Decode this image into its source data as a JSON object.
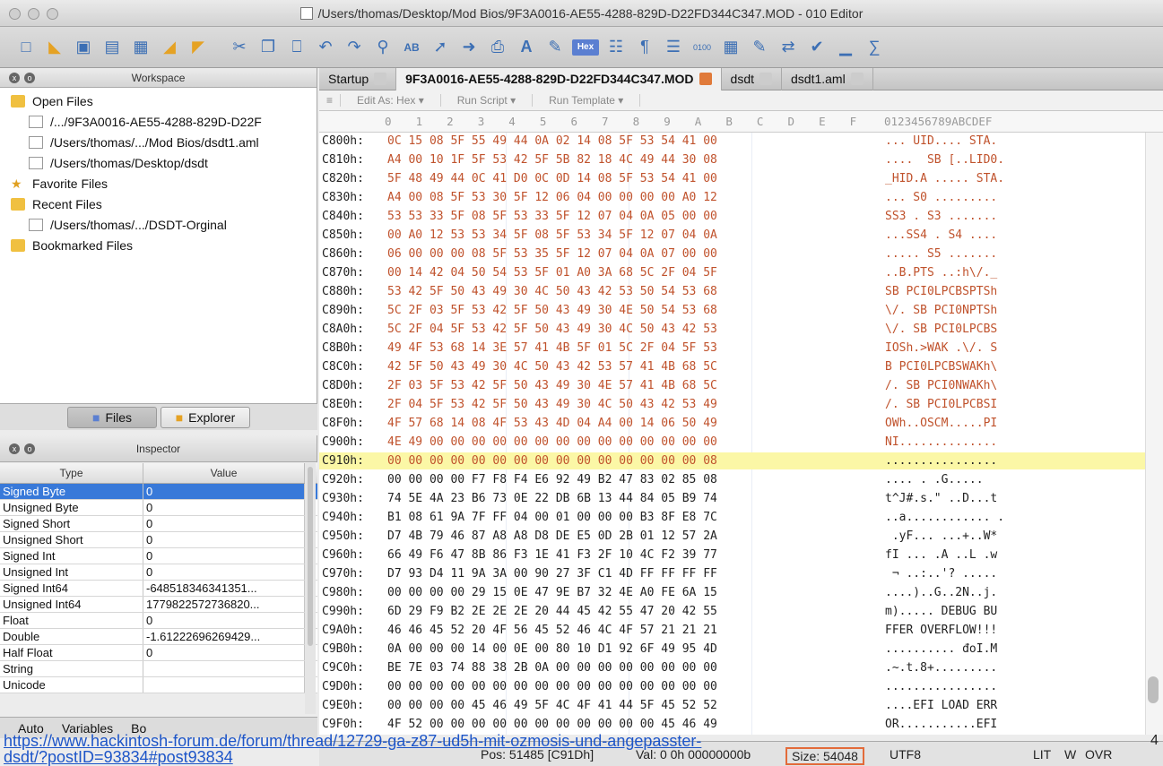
{
  "window": {
    "title": "/Users/thomas/Desktop/Mod Bios/9F3A0016-AE55-4288-829D-D22FD344C347.MOD - 010 Editor"
  },
  "toolbar": {
    "icons": [
      "new-file-icon",
      "open-file-icon",
      "save-icon",
      "save-all-icon",
      "workspace-icon",
      "folder-icon",
      "project-icon",
      "cut-icon",
      "copy-icon",
      "paste-icon",
      "undo-icon",
      "redo-icon",
      "find-icon",
      "replace-icon",
      "goto-icon",
      "jump-icon",
      "print-icon",
      "font-icon",
      "highlight-icon",
      "hex-mode-icon",
      "columns-icon",
      "paragraph-icon",
      "text-view-icon",
      "binary-icon",
      "calculator-icon",
      "template-icon",
      "compare-icon",
      "checksum-icon",
      "histogram-icon",
      "base-converter-icon"
    ],
    "hex_label": "Hex"
  },
  "workspace": {
    "title": "Workspace",
    "items": [
      {
        "label": "Open Files",
        "level": 0,
        "icon": "folder"
      },
      {
        "label": "/.../9F3A0016-AE55-4288-829D-D22F",
        "level": 1,
        "icon": "file"
      },
      {
        "label": "/Users/thomas/.../Mod Bios/dsdt1.aml",
        "level": 1,
        "icon": "file"
      },
      {
        "label": "/Users/thomas/Desktop/dsdt",
        "level": 1,
        "icon": "file"
      },
      {
        "label": "Favorite Files",
        "level": 0,
        "icon": "star"
      },
      {
        "label": "Recent Files",
        "level": 0,
        "icon": "folder"
      },
      {
        "label": "/Users/thomas/.../DSDT-Orginal",
        "level": 1,
        "icon": "file"
      },
      {
        "label": "Bookmarked Files",
        "level": 0,
        "icon": "folder"
      }
    ],
    "tabs": {
      "files": "Files",
      "explorer": "Explorer"
    }
  },
  "inspector": {
    "title": "Inspector",
    "col_type": "Type",
    "col_value": "Value",
    "rows": [
      {
        "type": "Signed Byte",
        "value": "0"
      },
      {
        "type": "Unsigned Byte",
        "value": "0"
      },
      {
        "type": "Signed Short",
        "value": "0"
      },
      {
        "type": "Unsigned Short",
        "value": "0"
      },
      {
        "type": "Signed Int",
        "value": "0"
      },
      {
        "type": "Unsigned Int",
        "value": "0"
      },
      {
        "type": "Signed Int64",
        "value": "-648518346341351..."
      },
      {
        "type": "Unsigned Int64",
        "value": "1779822572736820..."
      },
      {
        "type": "Float",
        "value": "0"
      },
      {
        "type": "Double",
        "value": "-1.61222696269429..."
      },
      {
        "type": "Half Float",
        "value": "0"
      },
      {
        "type": "String",
        "value": ""
      },
      {
        "type": "Unicode",
        "value": ""
      }
    ],
    "bottom_tabs": {
      "auto": "Auto",
      "variables": "Variables",
      "bookmarks": "Bo"
    }
  },
  "editor": {
    "tabs": [
      "Startup",
      "9F3A0016-AE55-4288-829D-D22FD344C347.MOD",
      "dsdt",
      "dsdt1.aml"
    ],
    "subbar": {
      "edit_as": "Edit As: Hex ▾",
      "run_script": "Run Script ▾",
      "run_template": "Run Template ▾"
    },
    "header_hex": "0  1  2  3  4  5  6  7  8  9  A  B  C  D  E  F",
    "header_ascii": "0123456789ABCDEF",
    "rows": [
      {
        "off": "C800h:",
        "hex": "0C 15 08 5F 55 49 44 0A 02 14 08 5F 53 54 41 00",
        "asc": "... UID.... STA.",
        "style": "orange"
      },
      {
        "off": "C810h:",
        "hex": "A4 00 10 1F 5F 53 42 5F 5B 82 18 4C 49 44 30 08",
        "asc": "....  SB [..LID0.",
        "style": "orange"
      },
      {
        "off": "C820h:",
        "hex": "5F 48 49 44 0C 41 D0 0C 0D 14 08 5F 53 54 41 00",
        "asc": "_HID.A ..... STA.",
        "style": "orange"
      },
      {
        "off": "C830h:",
        "hex": "A4 00 08 5F 53 30 5F 12 06 04 00 00 00 00 A0 12",
        "asc": "... S0 .........",
        "style": "orange"
      },
      {
        "off": "C840h:",
        "hex": "53 53 33 5F 08 5F 53 33 5F 12 07 04 0A 05 00 00",
        "asc": "SS3 . S3 .......",
        "style": "orange"
      },
      {
        "off": "C850h:",
        "hex": "00 A0 12 53 53 34 5F 08 5F 53 34 5F 12 07 04 0A",
        "asc": "...SS4 . S4 ....",
        "style": "orange"
      },
      {
        "off": "C860h:",
        "hex": "06 00 00 00 08 5F 53 35 5F 12 07 04 0A 07 00 00",
        "asc": "..... S5 .......",
        "style": "orange"
      },
      {
        "off": "C870h:",
        "hex": "00 14 42 04 50 54 53 5F 01 A0 3A 68 5C 2F 04 5F",
        "asc": "..B.PTS ..:h\\/._",
        "style": "orange"
      },
      {
        "off": "C880h:",
        "hex": "53 42 5F 50 43 49 30 4C 50 43 42 53 50 54 53 68",
        "asc": "SB PCI0LPCBSPTSh",
        "style": "orange"
      },
      {
        "off": "C890h:",
        "hex": "5C 2F 03 5F 53 42 5F 50 43 49 30 4E 50 54 53 68",
        "asc": "\\/. SB PCI0NPTSh",
        "style": "orange"
      },
      {
        "off": "C8A0h:",
        "hex": "5C 2F 04 5F 53 42 5F 50 43 49 30 4C 50 43 42 53",
        "asc": "\\/. SB PCI0LPCBS",
        "style": "orange"
      },
      {
        "off": "C8B0h:",
        "hex": "49 4F 53 68 14 3E 57 41 4B 5F 01 5C 2F 04 5F 53",
        "asc": "IOSh.>WAK .\\/. S",
        "style": "orange"
      },
      {
        "off": "C8C0h:",
        "hex": "42 5F 50 43 49 30 4C 50 43 42 53 57 41 4B 68 5C",
        "asc": "B PCI0LPCBSWAKh\\",
        "style": "orange"
      },
      {
        "off": "C8D0h:",
        "hex": "2F 03 5F 53 42 5F 50 43 49 30 4E 57 41 4B 68 5C",
        "asc": "/. SB PCI0NWAKh\\",
        "style": "orange"
      },
      {
        "off": "C8E0h:",
        "hex": "2F 04 5F 53 42 5F 50 43 49 30 4C 50 43 42 53 49",
        "asc": "/. SB PCI0LPCBSI",
        "style": "orange"
      },
      {
        "off": "C8F0h:",
        "hex": "4F 57 68 14 08 4F 53 43 4D 04 A4 00 14 06 50 49",
        "asc": "OWh..OSCM.....PI",
        "style": "orange"
      },
      {
        "off": "C900h:",
        "hex": "4E 49 00 00 00 00 00 00 00 00 00 00 00 00 00 00",
        "asc": "NI..............",
        "style": "orange"
      },
      {
        "off": "C910h:",
        "hex": "00 00 00 00 00 00 00 00 00 00 00 00 00 00 00 08",
        "asc": "................",
        "style": "yellow"
      },
      {
        "off": "C920h:",
        "hex": "00 00 00 00 F7 F8 F4 E6 92 49 B2 47 83 02 85 08",
        "asc": ".... . .G.....",
        "style": ""
      },
      {
        "off": "C930h:",
        "hex": "74 5E 4A 23 B6 73 0E 22 DB 6B 13 44 84 05 B9 74",
        "asc": "t^J#.s.\" ..D...t",
        "style": ""
      },
      {
        "off": "C940h:",
        "hex": "B1 08 61 9A 7F FF 04 00 01 00 00 00 B3 8F E8 7C",
        "asc": "..a............ .",
        "style": ""
      },
      {
        "off": "C950h:",
        "hex": "D7 4B 79 46 87 A8 A8 D8 DE E5 0D 2B 01 12 57 2A",
        "asc": " .yF... ...+..W*",
        "style": ""
      },
      {
        "off": "C960h:",
        "hex": "66 49 F6 47 8B 86 F3 1E 41 F3 2F 10 4C F2 39 77",
        "asc": "fI ... .A ..L .w",
        "style": ""
      },
      {
        "off": "C970h:",
        "hex": "D7 93 D4 11 9A 3A 00 90 27 3F C1 4D FF FF FF FF",
        "asc": " ¬ ..:..'? .....",
        "style": ""
      },
      {
        "off": "C980h:",
        "hex": "00 00 00 00 29 15 0E 47 9E B7 32 4E A0 FE 6A 15",
        "asc": "....)..G..2N..j.",
        "style": ""
      },
      {
        "off": "C990h:",
        "hex": "6D 29 F9 B2 2E 2E 2E 20 44 45 42 55 47 20 42 55",
        "asc": "m)..... DEBUG BU",
        "style": ""
      },
      {
        "off": "C9A0h:",
        "hex": "46 46 45 52 20 4F 56 45 52 46 4C 4F 57 21 21 21",
        "asc": "FFER OVERFLOW!!!",
        "style": ""
      },
      {
        "off": "C9B0h:",
        "hex": "0A 00 00 00 14 00 0E 00 80 10 D1 92 6F 49 95 4D",
        "asc": ".......... đoI.M",
        "style": ""
      },
      {
        "off": "C9C0h:",
        "hex": "BE 7E 03 74 88 38 2B 0A 00 00 00 00 00 00 00 00",
        "asc": ".~.t.8+.........",
        "style": ""
      },
      {
        "off": "C9D0h:",
        "hex": "00 00 00 00 00 00 00 00 00 00 00 00 00 00 00 00",
        "asc": "................",
        "style": ""
      },
      {
        "off": "C9E0h:",
        "hex": "00 00 00 00 45 46 49 5F 4C 4F 41 44 5F 45 52 52",
        "asc": "....EFI LOAD ERR",
        "style": ""
      },
      {
        "off": "C9F0h:",
        "hex": "4F 52 00 00 00 00 00 00 00 00 00 00 00 45 46 49",
        "asc": "OR...........EFI",
        "style": ""
      }
    ]
  },
  "status": {
    "pos": "Pos: 51485 [C91Dh]",
    "val": "Val: 0 0h 00000000b",
    "size": "Size: 54048",
    "encoding": "UTF8",
    "lit": "LIT",
    "w": "W",
    "ovr": "OVR"
  },
  "footer": {
    "link_line1": "https://www.hackintosh-forum.de/forum/thread/12729-ga-z87-ud5h-mit-ozmosis-und-angepasster-",
    "link_line2": "dsdt/?postID=93834#post93834",
    "page_number": "4"
  }
}
